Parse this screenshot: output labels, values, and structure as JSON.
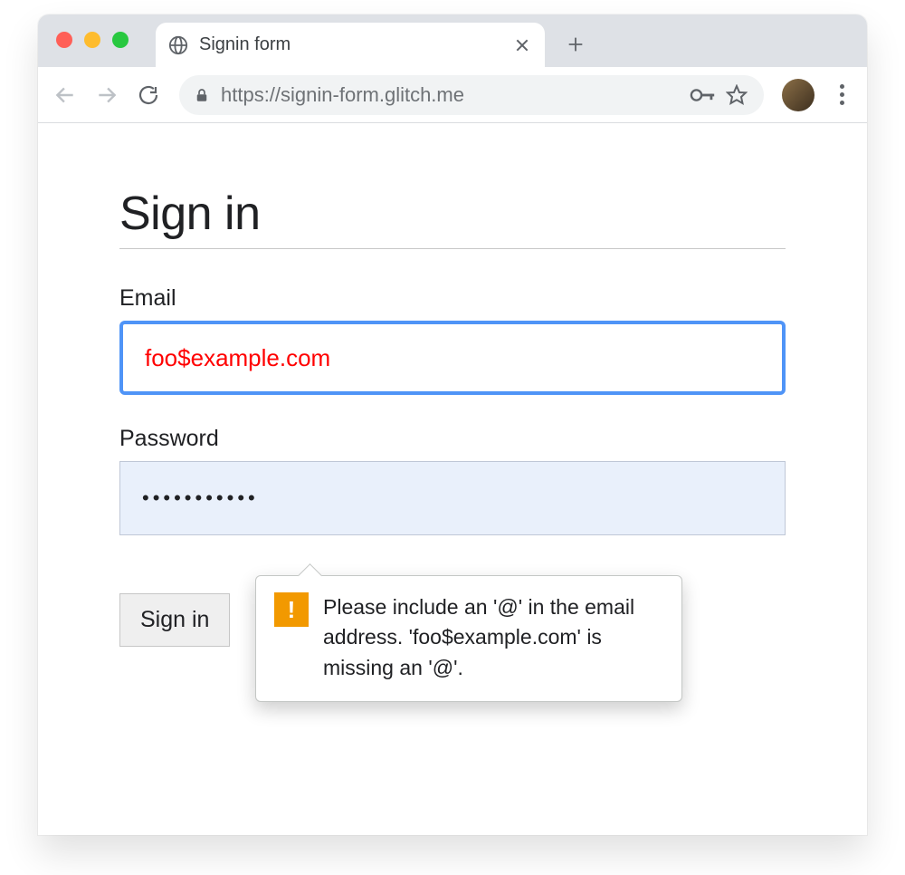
{
  "browser": {
    "tab_title": "Signin form",
    "url": "https://signin-form.glitch.me"
  },
  "page": {
    "heading": "Sign in",
    "email": {
      "label": "Email",
      "value": "foo$example.com"
    },
    "password": {
      "label": "Password",
      "value": "•••••••••••"
    },
    "submit_label": "Sign in",
    "validation_message": "Please include an '@' in the email address. 'foo$example.com' is missing an '@'."
  }
}
